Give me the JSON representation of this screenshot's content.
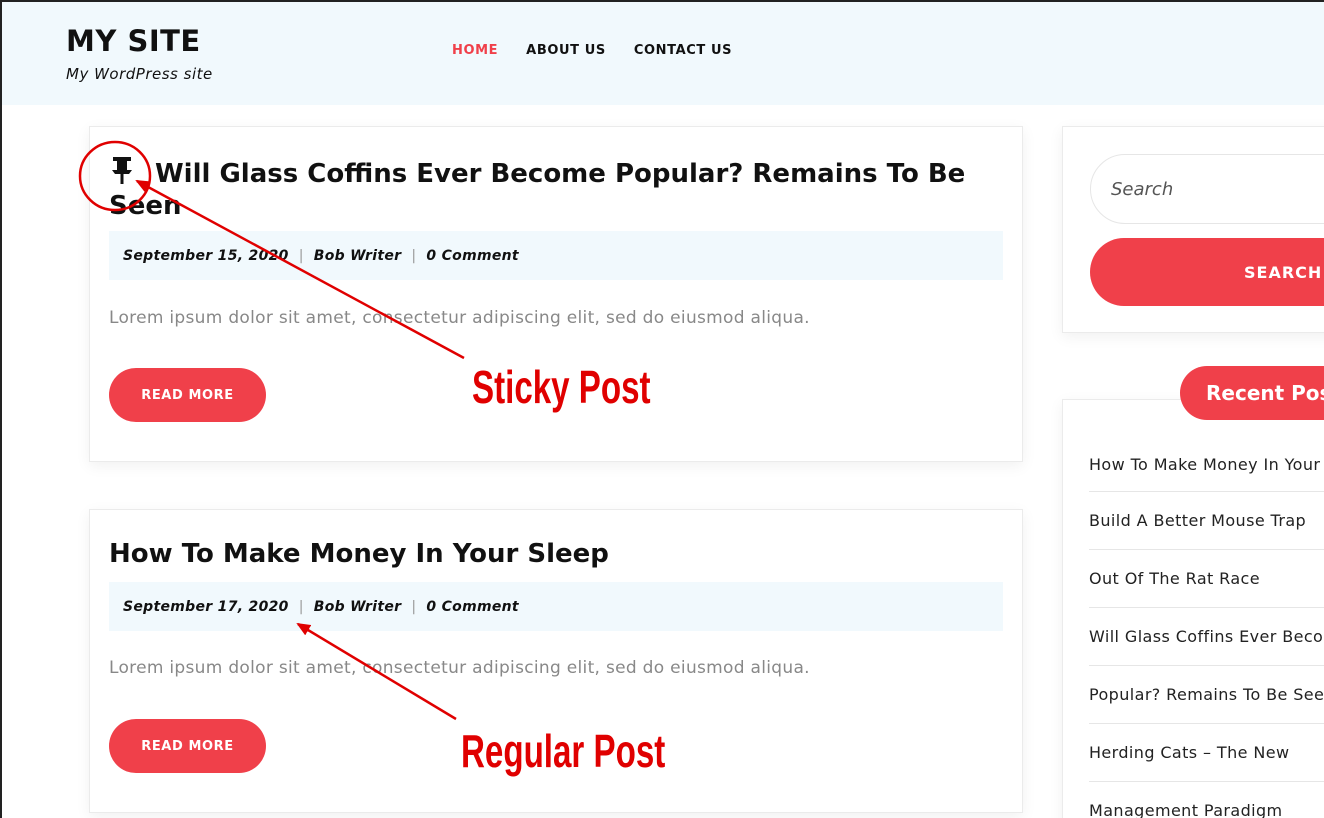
{
  "header": {
    "site_title": "MY SITE",
    "tagline": "My WordPress site",
    "nav": [
      {
        "label": "HOME",
        "active": true
      },
      {
        "label": "ABOUT US",
        "active": false
      },
      {
        "label": "CONTACT US",
        "active": false
      }
    ]
  },
  "posts": [
    {
      "type": "sticky",
      "icon": "pin-icon",
      "title": "Will Glass Coffins Ever Become Popular? Remains To Be Seen",
      "date": "September 15, 2020",
      "author": "Bob Writer",
      "comments": "0 Comment",
      "excerpt": "Lorem ipsum dolor sit amet, consectetur adipiscing elit, sed do eiusmod aliqua.",
      "read_more": "READ MORE"
    },
    {
      "type": "regular",
      "title": "How To Make Money In Your Sleep",
      "date": "September 17, 2020",
      "author": "Bob Writer",
      "comments": "0 Comment",
      "excerpt": "Lorem ipsum dolor sit amet, consectetur adipiscing elit, sed do eiusmod aliqua.",
      "read_more": "READ MORE"
    }
  ],
  "sidebar": {
    "search": {
      "placeholder": "Search",
      "button_label": "SEARCH"
    },
    "recent_posts": {
      "title": "Recent Posts",
      "items": [
        "How To Make Money In Your Sleep",
        "Build A Better Mouse Trap",
        "Out Of The Rat Race",
        "Will Glass Coffins Ever Become",
        "Popular? Remains To Be Seen",
        "Herding Cats – The New",
        "Management Paradigm"
      ]
    }
  },
  "annotations": {
    "sticky_label": "Sticky Post",
    "regular_label": "Regular Post"
  },
  "colors": {
    "accent": "#f0404a",
    "header_bg": "#f1f9fd",
    "annotation": "#e00000"
  }
}
